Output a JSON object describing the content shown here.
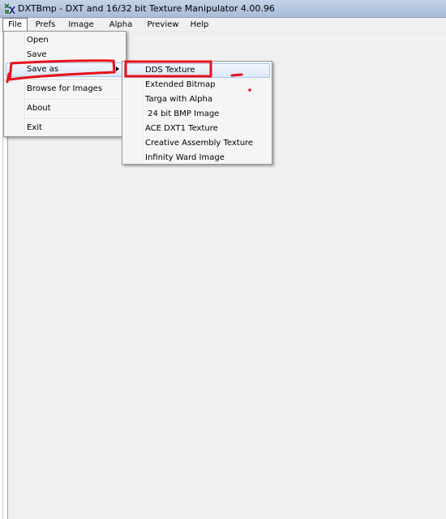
{
  "window": {
    "title": "DXTBmp - DXT and 16/32 bit Texture Manipulator  4.00.96",
    "icon": "dxtbmp-app-icon"
  },
  "menubar": {
    "items": [
      {
        "label": "File",
        "open": true
      },
      {
        "label": "Prefs"
      },
      {
        "label": "Image"
      },
      {
        "label": "Alpha"
      },
      {
        "label": "Preview"
      },
      {
        "label": "Help"
      }
    ]
  },
  "file_menu": {
    "items": {
      "open": "Open",
      "save": "Save",
      "save_as": "Save as",
      "browse": "Browse for Images",
      "about": "About",
      "exit": "Exit"
    },
    "highlighted": "Save as"
  },
  "save_as_menu": {
    "items": [
      "DDS Texture",
      "Extended Bitmap",
      "Targa with Alpha",
      " 24 bit BMP Image",
      "ACE DXT1 Texture",
      "Creative Assembly Texture",
      "Infinity Ward Image"
    ],
    "highlighted": "DDS Texture"
  },
  "colors": {
    "annotation_red": "#e8101a",
    "menu_highlight": "#dbe8f7",
    "menu_highlight_border": "#a8c8ec",
    "titlebar": "#b4c6de"
  }
}
